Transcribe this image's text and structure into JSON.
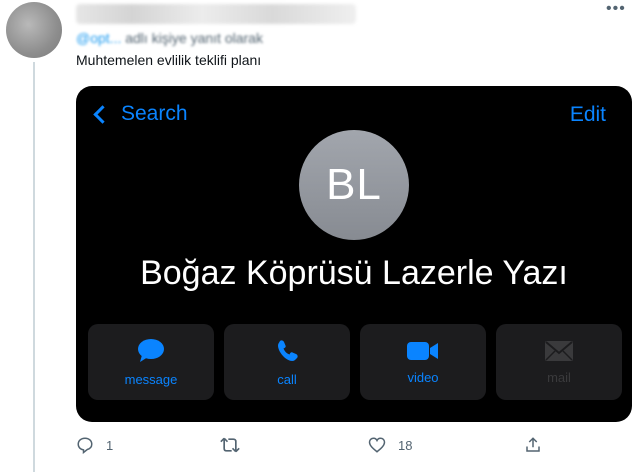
{
  "tweet": {
    "reply_prefix": "@opt...",
    "reply_suffix": " adlı kişiye yanıt olarak",
    "text": "Muhtemelen evlilik teklifi planı",
    "more_icon": "more-icon"
  },
  "contact_card": {
    "back_label": "Search",
    "edit_label": "Edit",
    "initials": "BL",
    "name": "Boğaz Köprüsü Lazerle Yazı",
    "actions": [
      {
        "label": "message",
        "icon": "message-icon"
      },
      {
        "label": "call",
        "icon": "phone-icon"
      },
      {
        "label": "video",
        "icon": "video-icon"
      },
      {
        "label": "mail",
        "icon": "mail-icon"
      }
    ],
    "accent_color": "#0a84ff"
  },
  "footer": {
    "replies": "1",
    "retweets": "",
    "likes": "18"
  }
}
